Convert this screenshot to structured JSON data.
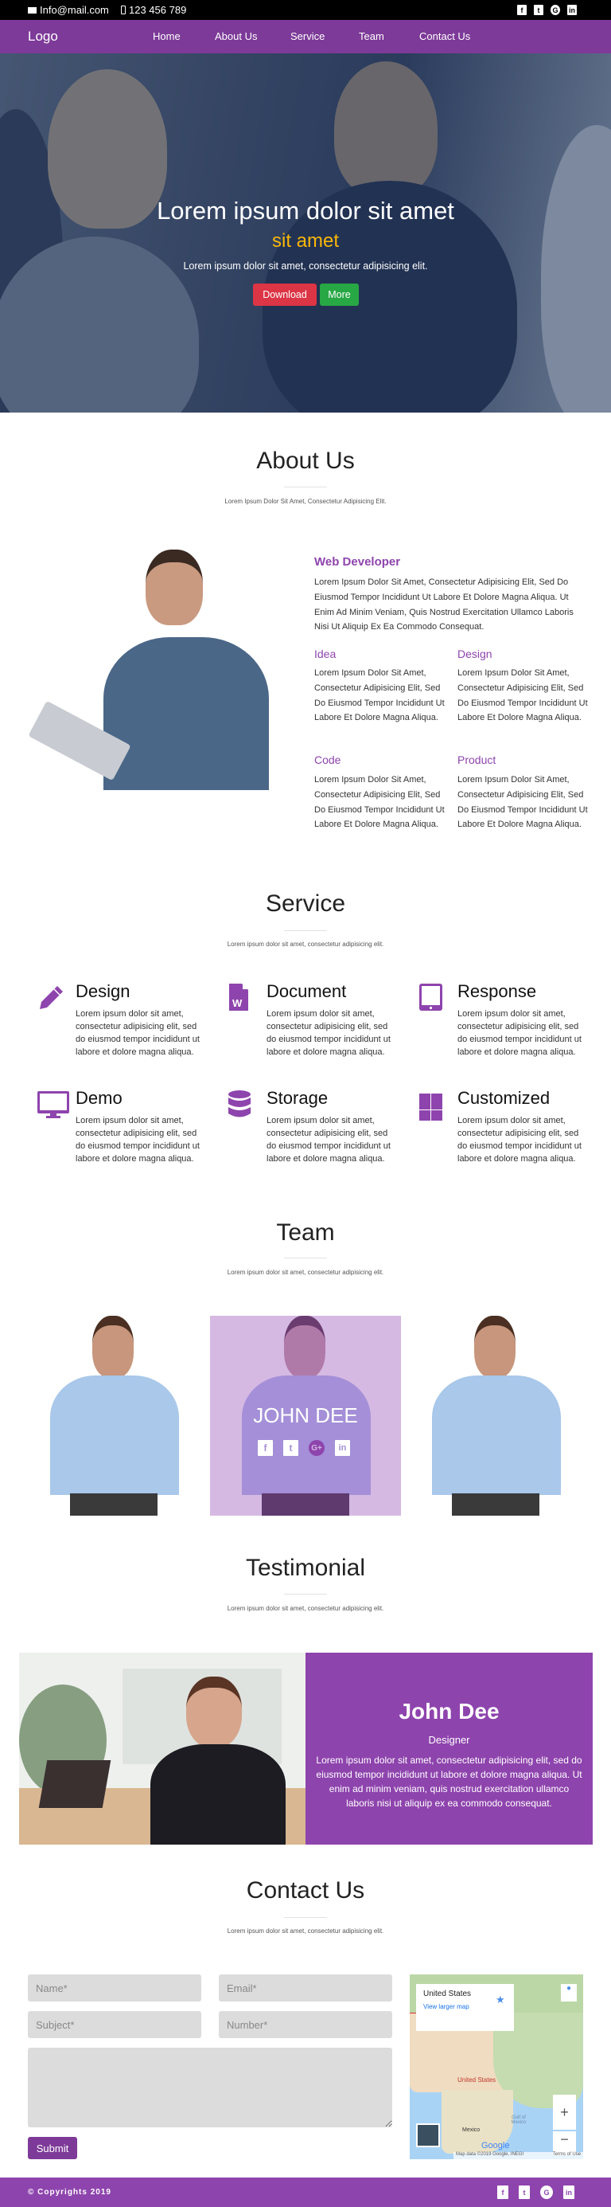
{
  "topbar": {
    "email": "Info@mail.com",
    "phone": "123 456 789",
    "social": [
      "facebook-icon",
      "twitter-icon",
      "google-plus-icon",
      "linkedin-icon"
    ]
  },
  "nav": {
    "logo": "Logo",
    "items": [
      "Home",
      "About Us",
      "Service",
      "Team",
      "Contact Us"
    ]
  },
  "hero": {
    "title": "Lorem ipsum dolor sit amet",
    "highlight": "sit amet",
    "subtitle": "Lorem ipsum dolor sit amet, consectetur adipisicing elit.",
    "download": "Download",
    "more": "More"
  },
  "about": {
    "title": "About Us",
    "subtitle": "Lorem Ipsum Dolor Sit Amet, Consectetur Adipisicing Elit.",
    "role": "Web Developer",
    "role_text": "Lorem Ipsum Dolor Sit Amet, Consectetur Adipisicing Elit, Sed Do Eiusmod Tempor Incididunt Ut Labore Et Dolore Magna Aliqua. Ut Enim Ad Minim Veniam, Quis Nostrud Exercitation Ullamco Laboris Nisi Ut Aliquip Ex Ea Commodo Consequat.",
    "features": [
      {
        "title": "Idea",
        "text": "Lorem Ipsum Dolor Sit Amet, Consectetur Adipisicing Elit, Sed Do Eiusmod Tempor Incididunt Ut Labore Et Dolore Magna Aliqua."
      },
      {
        "title": "Design",
        "text": "Lorem Ipsum Dolor Sit Amet, Consectetur Adipisicing Elit, Sed Do Eiusmod Tempor Incididunt Ut Labore Et Dolore Magna Aliqua."
      },
      {
        "title": "Code",
        "text": "Lorem Ipsum Dolor Sit Amet, Consectetur Adipisicing Elit, Sed Do Eiusmod Tempor Incididunt Ut Labore Et Dolore Magna Aliqua."
      },
      {
        "title": "Product",
        "text": "Lorem Ipsum Dolor Sit Amet, Consectetur Adipisicing Elit, Sed Do Eiusmod Tempor Incididunt Ut Labore Et Dolore Magna Aliqua."
      }
    ]
  },
  "service": {
    "title": "Service",
    "subtitle": "Lorem ipsum dolor sit amet, consectetur adipisicing elit.",
    "items": [
      {
        "title": "Design",
        "icon": "pencil-icon",
        "text": "Lorem ipsum dolor sit amet, consectetur adipisicing elit, sed do eiusmod tempor incididunt ut labore et dolore magna aliqua."
      },
      {
        "title": "Document",
        "icon": "word-document-icon",
        "text": "Lorem ipsum dolor sit amet, consectetur adipisicing elit, sed do eiusmod tempor incididunt ut labore et dolore magna aliqua."
      },
      {
        "title": "Response",
        "icon": "tablet-icon",
        "text": "Lorem ipsum dolor sit amet, consectetur adipisicing elit, sed do eiusmod tempor incididunt ut labore et dolore magna aliqua."
      },
      {
        "title": "Demo",
        "icon": "desktop-icon",
        "text": "Lorem ipsum dolor sit amet, consectetur adipisicing elit, sed do eiusmod tempor incididunt ut labore et dolore magna aliqua."
      },
      {
        "title": "Storage",
        "icon": "database-icon",
        "text": "Lorem ipsum dolor sit amet, consectetur adipisicing elit, sed do eiusmod tempor incididunt ut labore et dolore magna aliqua."
      },
      {
        "title": "Customized",
        "icon": "windows-grid-icon",
        "text": "Lorem ipsum dolor sit amet, consectetur adipisicing elit, sed do eiusmod tempor incididunt ut labore et dolore magna aliqua."
      }
    ]
  },
  "team": {
    "title": "Team",
    "subtitle": "Lorem ipsum dolor sit amet, consectetur adipisicing elit.",
    "featured_name": "JOHN DEE"
  },
  "testimonial": {
    "title": "Testimonial",
    "subtitle": "Lorem ipsum dolor sit amet, consectetur adipisicing elit.",
    "name": "John Dee",
    "role": "Designer",
    "text": "Lorem ipsum dolor sit amet, consectetur adipisicing elit, sed do eiusmod tempor incididunt ut labore et dolore magna aliqua. Ut enim ad minim veniam, quis nostrud exercitation ullamco laboris nisi ut aliquip ex ea commodo consequat."
  },
  "contact": {
    "title": "Contact Us",
    "subtitle": "Lorem ipsum dolor sit amet, consectetur adipisicing elit.",
    "name_ph": "Name*",
    "email_ph": "Email*",
    "subject_ph": "Subject*",
    "number_ph": "Number*",
    "submit": "Submit",
    "map": {
      "place": "United States",
      "link": "View larger map",
      "label_country": "United States",
      "label_mexico": "Mexico",
      "label_gulf": "Gulf of Mexico",
      "attribution": "Map data ©2019 Google, INEGI",
      "terms": "Terms of Use",
      "google": "Google"
    }
  },
  "footer": {
    "copyright": "© Copyrights 2019"
  },
  "colors": {
    "nav": "#7d3a98",
    "accent": "#8e44ad",
    "highlight": "#f9b707",
    "download": "#dc3545",
    "more": "#28a745"
  }
}
